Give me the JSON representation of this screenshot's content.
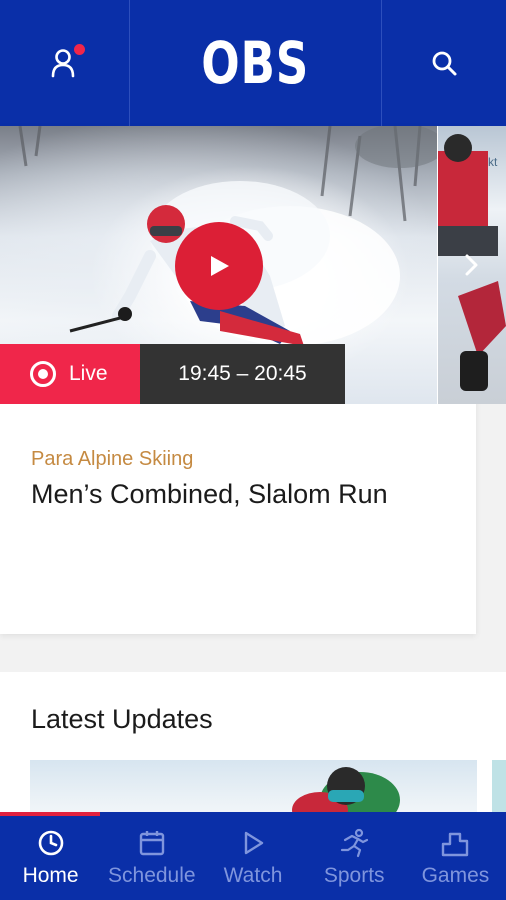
{
  "header": {
    "logo_text": "OBS",
    "profile_icon": "user-icon",
    "search_icon": "search-icon",
    "notification_color": "#f0264a"
  },
  "hero": {
    "live_label": "Live",
    "time_range": "19:45 – 20:45",
    "sport": "Para Alpine Skiing",
    "event_title": "Men’s Combined, Slalom Run",
    "play_icon": "play-icon",
    "next_icon": "chevron-right-icon"
  },
  "updates": {
    "title": "Latest Updates"
  },
  "nav": {
    "items": [
      {
        "label": "Home",
        "icon": "clock-icon",
        "active": true
      },
      {
        "label": "Schedule",
        "icon": "calendar-icon",
        "active": false
      },
      {
        "label": "Watch",
        "icon": "play-outline-icon",
        "active": false
      },
      {
        "label": "Sports",
        "icon": "runner-icon",
        "active": false
      },
      {
        "label": "Games",
        "icon": "podium-icon",
        "active": false
      }
    ]
  },
  "colors": {
    "brand_blue": "#0a2fa8",
    "live_red": "#f0264a",
    "sport_gold": "#c58a42"
  }
}
